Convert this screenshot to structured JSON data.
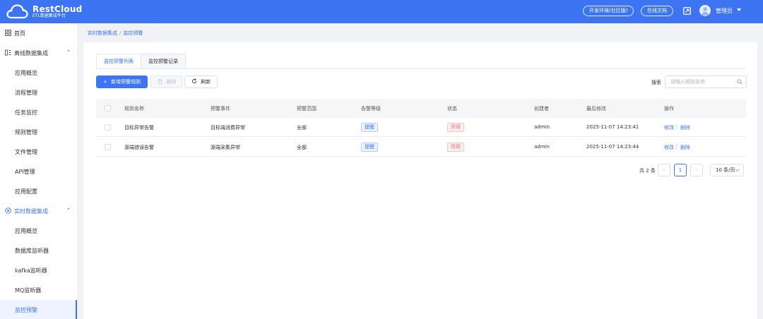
{
  "header": {
    "logo_title": "RestCloud",
    "logo_subtitle": "ETL数据集成平台",
    "env_button": "开发环境(社区版)",
    "docs_button": "在线文档",
    "user_name": "管理员",
    "accent_color": "#3c74f2"
  },
  "sidebar": {
    "items": [
      {
        "label": "首页",
        "icon": "home-grid-icon"
      },
      {
        "label": "离线数据集成",
        "icon": "offline-integration-icon",
        "expanded": true
      },
      {
        "label": "应用概览"
      },
      {
        "label": "流程管理"
      },
      {
        "label": "任务监控"
      },
      {
        "label": "规则管理"
      },
      {
        "label": "文件管理"
      },
      {
        "label": "API管理"
      },
      {
        "label": "应用配置"
      },
      {
        "label": "实时数据集成",
        "icon": "realtime-integration-icon",
        "expanded": true
      },
      {
        "label": "应用概览"
      },
      {
        "label": "数据库监听器"
      },
      {
        "label": "kafka监听器"
      },
      {
        "label": "MQ监听器"
      },
      {
        "label": "监控预警",
        "active": true
      }
    ]
  },
  "breadcrumb": {
    "items": [
      "实时数据集成",
      "监控预警"
    ],
    "separator": "/"
  },
  "tabs": [
    {
      "label": "监控预警列表",
      "active": true
    },
    {
      "label": "监控预警记录",
      "active": false
    }
  ],
  "toolbar": {
    "add_label": "新增预警规则",
    "delete_label": "删除",
    "refresh_label": "刷新",
    "search_label": "搜索",
    "search_placeholder": "请输入规则名称",
    "search_value": ""
  },
  "table": {
    "columns": [
      "规则名称",
      "预警事件",
      "预警范围",
      "告警等级",
      "状态",
      "创建者",
      "最后修改",
      "操作"
    ],
    "rows": [
      {
        "name": "目标异常告警",
        "event": "目标端消费异常",
        "scope": "全部",
        "level": "提醒",
        "status": "停用",
        "creator": "admin",
        "modified": "2025-11-07 14:23:41",
        "edit": "修改",
        "delete": "删除"
      },
      {
        "name": "源端错误告警",
        "event": "源端采集异常",
        "scope": "全部",
        "level": "提醒",
        "status": "停用",
        "creator": "admin",
        "modified": "2025-11-07 14:23:44",
        "edit": "修改",
        "delete": "删除"
      }
    ]
  },
  "pagination": {
    "total_text": "共 2 条",
    "current_page": "1",
    "page_size": "10 条/页"
  }
}
